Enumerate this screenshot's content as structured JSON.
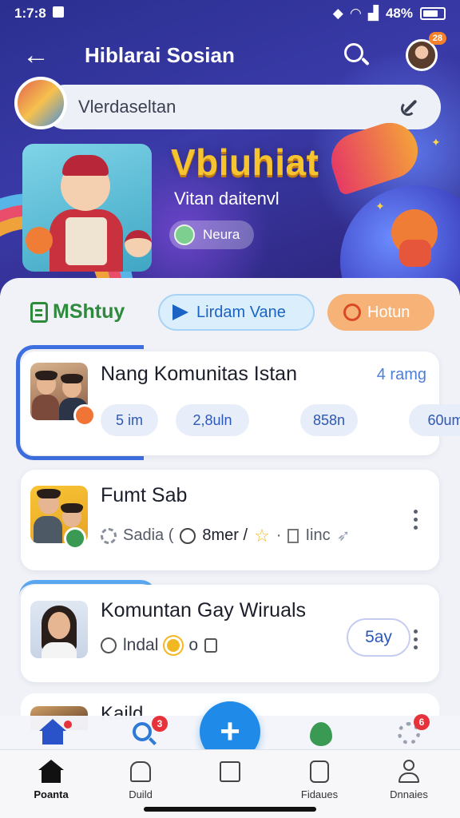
{
  "status_bar": {
    "time": "1:7:8",
    "battery": "48%"
  },
  "app_bar": {
    "title": "Hiblarai Sosian",
    "notification_count": "28"
  },
  "search": {
    "placeholder": "Vlerdaseltan"
  },
  "banner": {
    "title": "Vbiuhiat",
    "subtitle": "Vitan daitenvl",
    "chip_label": "Neura"
  },
  "filters": {
    "text_chip": "MShtuy",
    "blue_chip": "Lirdam Vane",
    "orange_chip": "Hotun"
  },
  "cards": [
    {
      "title": "Nang Komunitas Istan",
      "members": "4 ramg",
      "stats": [
        "5 im",
        "2,8uln",
        "858n",
        "60um"
      ]
    },
    {
      "title": "Fumt Sab",
      "meta": [
        "Sadia (",
        "8mer /",
        "Iinc"
      ]
    },
    {
      "title": "Komuntan Gay Wiruals",
      "meta": [
        "lndal",
        "o"
      ],
      "action": "5ay"
    },
    {
      "title": "Kaild"
    }
  ],
  "quick_bar": {
    "search_badge": "3",
    "settings_badge": "6"
  },
  "fab": {
    "label": "+"
  },
  "tabs": [
    {
      "label": "Poanta"
    },
    {
      "label": "Duild"
    },
    {
      "label": "Fidaues"
    },
    {
      "label": "Dnnaies"
    }
  ],
  "colors": {
    "header": "#2a2f8f",
    "accent_blue": "#1f8ae8",
    "banner_title": "#f6c431",
    "green": "#2e8b3c",
    "orange": "#f7b278"
  }
}
